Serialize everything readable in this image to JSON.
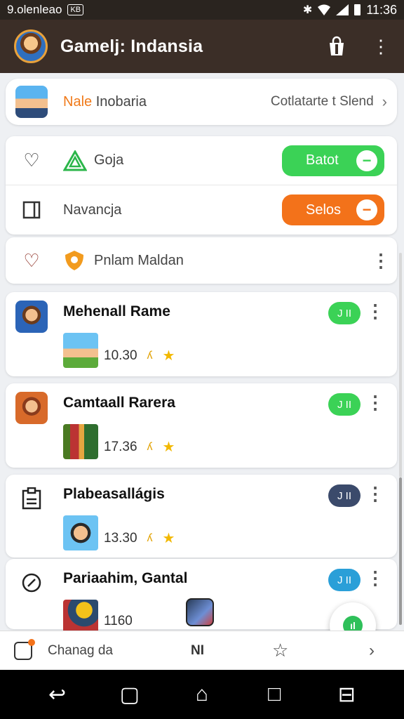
{
  "status_bar": {
    "carrier": "9.olenleao",
    "badge": "KB",
    "time": "11:36"
  },
  "app_bar": {
    "title": "Gamelj: Indansia"
  },
  "profile": {
    "name_highlight": "Nale",
    "name_rest": " Inobaria",
    "link_label": "Cotlatarte t Slend"
  },
  "settings_rows": [
    {
      "label": "Goja",
      "pill_label": "Batot",
      "pill_color": "#3bd256"
    },
    {
      "label": "Navancja",
      "pill_label": "Selos",
      "pill_color": "#f3721a"
    },
    {
      "label": "Pnlam Maldan"
    }
  ],
  "games": [
    {
      "title": "Mehenall Rame",
      "badge": "J II",
      "badge_color": "#3bd256",
      "meta": "10.30"
    },
    {
      "title": "Camtaall Rarera",
      "badge": "J II",
      "badge_color": "#3bd256",
      "meta": "17.36"
    },
    {
      "title": "Plabeasallágis",
      "badge": "J II",
      "badge_color": "#3b4a6b",
      "meta": "13.30"
    },
    {
      "title": "Pariaahim, Gantal",
      "badge": "J II",
      "badge_color": "#2a9fd8",
      "meta": "1160"
    }
  ],
  "bottom_nav": {
    "label": "Chanag da",
    "mid_label": "NI"
  },
  "icons": {
    "heart": "heart-icon",
    "triangle": "triangle-icon",
    "square": "square-icon",
    "shield": "shield-icon",
    "star": "star-icon"
  },
  "colors": {
    "appbar": "#3b2e27",
    "accent_orange": "#f07a1a",
    "accent_green": "#3bd256"
  }
}
